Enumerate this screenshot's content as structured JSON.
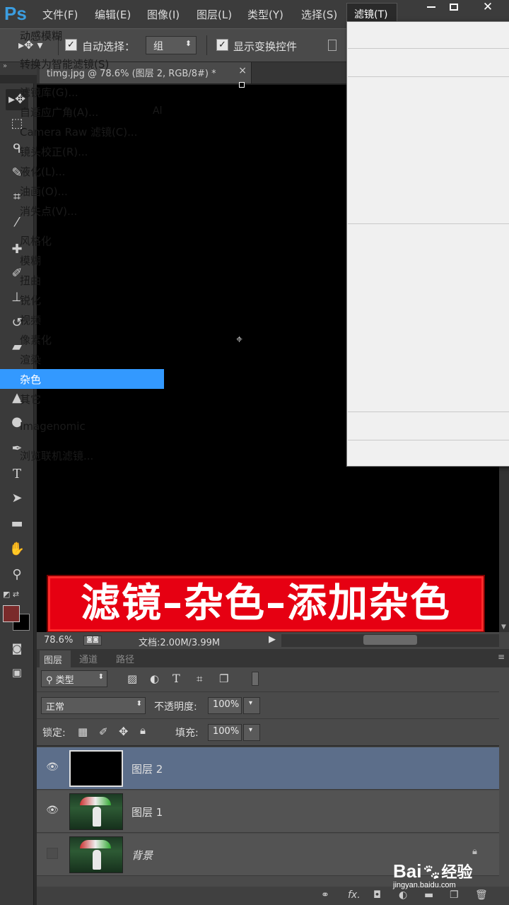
{
  "app": {
    "logo": "Ps"
  },
  "menubar": {
    "items": [
      "文件(F)",
      "编辑(E)",
      "图像(I)",
      "图层(L)",
      "类型(Y)",
      "选择(S)"
    ],
    "active": "滤镜(T)"
  },
  "options": {
    "auto_select_label": "自动选择：",
    "auto_select_value": "组",
    "show_transform_label": "显示变换控件"
  },
  "document": {
    "tab_title": "timg.jpg @ 78.6% (图层 2, RGB/8#) *",
    "close": "×"
  },
  "banner": {
    "text": "滤镜–杂色–添加杂色"
  },
  "statusbar": {
    "zoom": "78.6%",
    "doc_info": "文档:2.00M/3.99M"
  },
  "layers_panel": {
    "tabs": [
      "图层",
      "通道",
      "路径"
    ],
    "filter_type": "类型",
    "blend_mode": "正常",
    "opacity_label": "不透明度:",
    "opacity_value": "100%",
    "lock_label": "锁定:",
    "fill_label": "填充:",
    "fill_value": "100%",
    "layers": [
      {
        "name": "图层 2",
        "selected": true,
        "visible": true
      },
      {
        "name": "图层 1",
        "selected": false,
        "visible": true
      },
      {
        "name": "背景",
        "selected": false,
        "visible": false,
        "locked": true
      }
    ]
  },
  "filter_menu": {
    "items": [
      {
        "label": "动感模糊"
      },
      {
        "label": "转换为智能滤镜(S)"
      },
      {
        "label": "滤镜库(G)..."
      },
      {
        "label": "自适应广角(A)...",
        "shortcut": "Al"
      },
      {
        "label": "Camera Raw 滤镜(C)..."
      },
      {
        "label": "镜头校正(R)..."
      },
      {
        "label": "液化(L)..."
      },
      {
        "label": "油画(O)..."
      },
      {
        "label": "消失点(V)..."
      },
      {
        "label": "风格化"
      },
      {
        "label": "模糊"
      },
      {
        "label": "扭曲"
      },
      {
        "label": "锐化"
      },
      {
        "label": "视频"
      },
      {
        "label": "像素化"
      },
      {
        "label": "渲染"
      },
      {
        "label": "杂色",
        "highlighted": true
      },
      {
        "label": "其它"
      },
      {
        "label": "Imagenomic"
      },
      {
        "label": "浏览联机滤镜..."
      }
    ]
  },
  "watermark": {
    "brand": "Bai",
    "brand2": "经验",
    "url": "jingyan.baidu.com"
  },
  "colors": {
    "accent": "#3399ff",
    "banner": "#e60012",
    "selected_layer": "#5c6e8a"
  }
}
